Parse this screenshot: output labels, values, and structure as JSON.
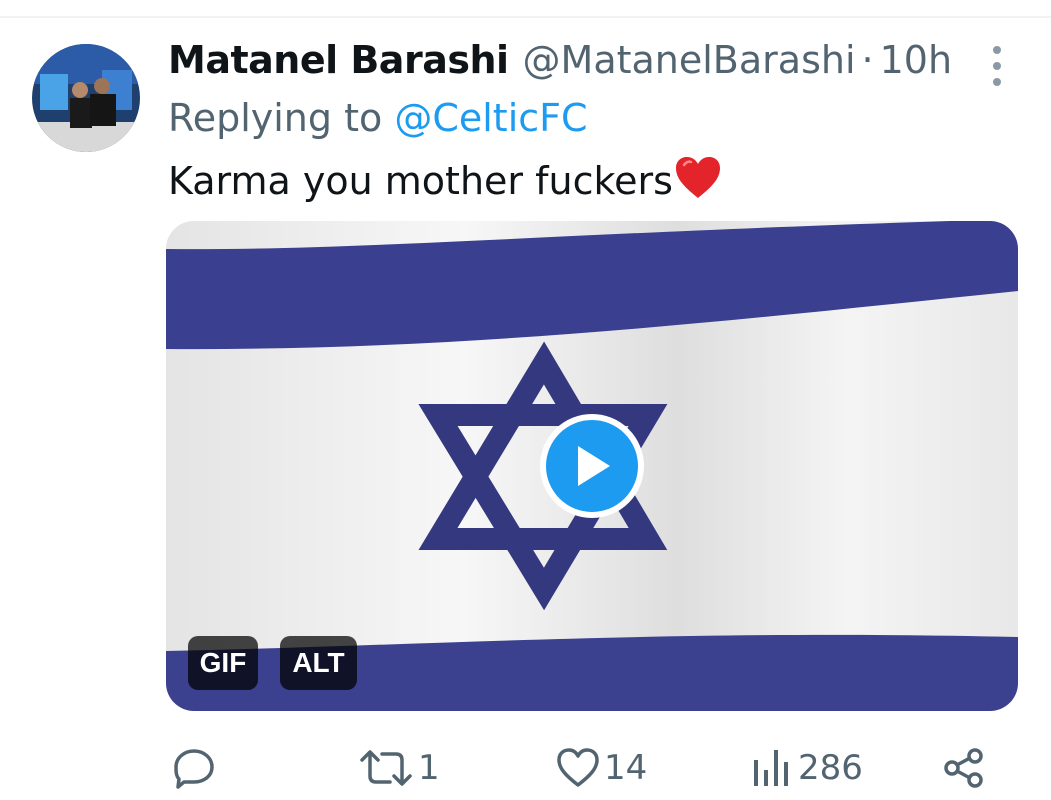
{
  "tweet": {
    "display_name": "Matanel Barashi",
    "handle": "@MatanelBarashi",
    "separator": "·",
    "time": "10h",
    "replying_prefix": "Replying to",
    "replying_to": "@CelticFC",
    "text": "Karma you mother fuckers",
    "emoji": "heart-emoji"
  },
  "media": {
    "type": "gif",
    "badges": {
      "gif": "GIF",
      "alt": "ALT"
    },
    "colors": {
      "stripe": "#3a3f8f",
      "field": "#f2f2f2",
      "play": "#1d9bf0"
    }
  },
  "actions": {
    "reply": {
      "icon": "reply-icon",
      "count": ""
    },
    "retweet": {
      "icon": "retweet-icon",
      "count": "1"
    },
    "like": {
      "icon": "heart-icon",
      "count": "14"
    },
    "views": {
      "icon": "views-icon",
      "count": "286"
    },
    "share": {
      "icon": "share-icon"
    }
  },
  "colors": {
    "text": "#0f1419",
    "secondary": "#536471",
    "link": "#1d9bf0",
    "divider": "#eff3f4"
  }
}
